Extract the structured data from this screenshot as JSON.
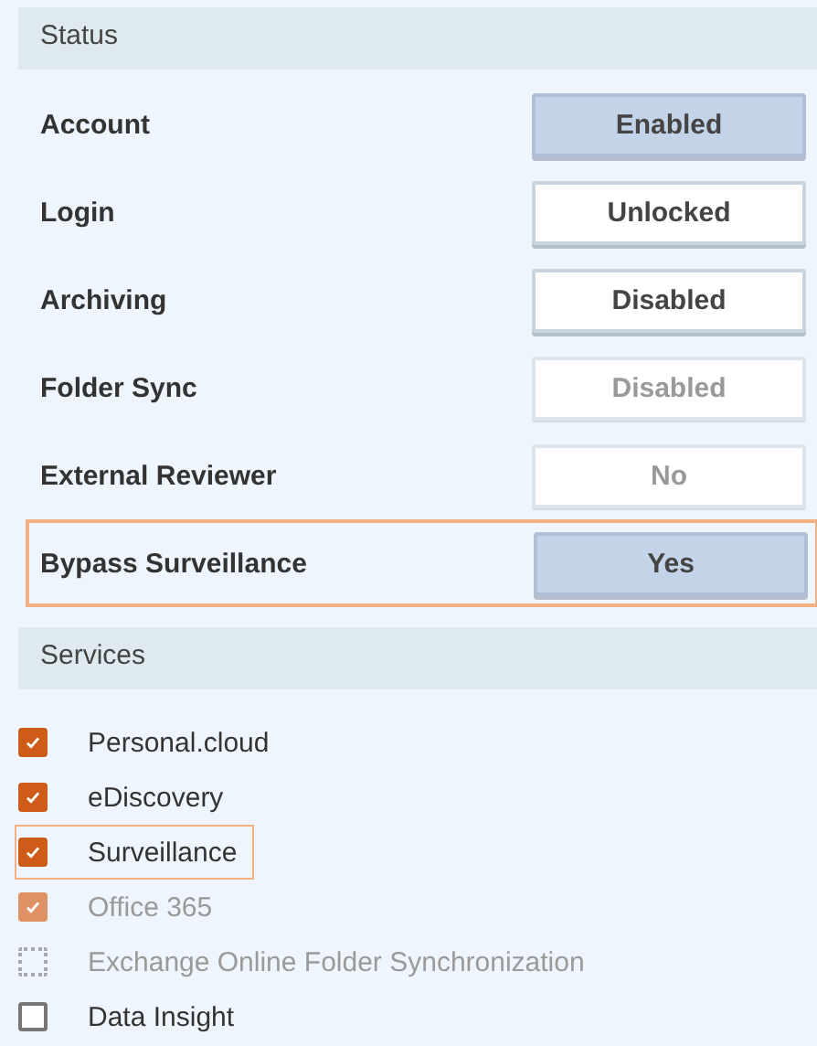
{
  "sections": [
    {
      "kind": "status",
      "title": "Status",
      "rows": [
        {
          "label": "Account",
          "value": "Enabled",
          "on": true,
          "disabled": false,
          "highlighted": false
        },
        {
          "label": "Login",
          "value": "Unlocked",
          "on": false,
          "disabled": false,
          "highlighted": false
        },
        {
          "label": "Archiving",
          "value": "Disabled",
          "on": false,
          "disabled": false,
          "highlighted": false
        },
        {
          "label": "Folder Sync",
          "value": "Disabled",
          "on": false,
          "disabled": true,
          "highlighted": false
        },
        {
          "label": "External Reviewer",
          "value": "No",
          "on": false,
          "disabled": true,
          "highlighted": false
        },
        {
          "label": "Bypass Surveillance",
          "value": "Yes",
          "on": true,
          "disabled": false,
          "highlighted": true
        }
      ]
    },
    {
      "kind": "services",
      "title": "Services",
      "items": [
        {
          "label": "Personal.cloud",
          "checked": true,
          "disabled": false,
          "highlighted": false
        },
        {
          "label": "eDiscovery",
          "checked": true,
          "disabled": false,
          "highlighted": false
        },
        {
          "label": "Surveillance",
          "checked": true,
          "disabled": false,
          "highlighted": true
        },
        {
          "label": "Office 365",
          "checked": true,
          "disabled": true,
          "highlighted": false
        },
        {
          "label": "Exchange Online Folder Synchronization",
          "checked": false,
          "disabled": true,
          "highlighted": false
        },
        {
          "label": "Data Insight",
          "checked": false,
          "disabled": false,
          "highlighted": false
        }
      ]
    }
  ]
}
